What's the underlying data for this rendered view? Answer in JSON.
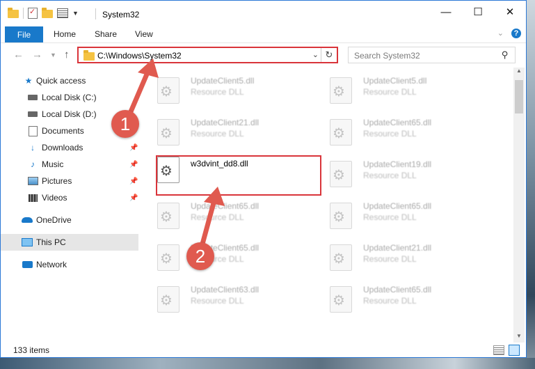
{
  "window": {
    "title": "System32",
    "controls": {
      "minimize": "—",
      "maximize": "☐",
      "close": "✕"
    }
  },
  "ribbon": {
    "tabs": [
      "File",
      "Home",
      "Share",
      "View"
    ],
    "help": "?"
  },
  "navigation": {
    "address": "C:\\Windows\\System32",
    "search_placeholder": "Search System32"
  },
  "sidebar": {
    "items": [
      {
        "label": "Quick access",
        "icon": "star-icon",
        "pinned": false
      },
      {
        "label": "Local Disk (C:)",
        "icon": "drive-icon",
        "pinned": false
      },
      {
        "label": "Local Disk (D:)",
        "icon": "drive-icon",
        "pinned": false
      },
      {
        "label": "Documents",
        "icon": "documents-icon",
        "pinned": true
      },
      {
        "label": "Downloads",
        "icon": "download-icon",
        "pinned": true
      },
      {
        "label": "Music",
        "icon": "music-icon",
        "pinned": true
      },
      {
        "label": "Pictures",
        "icon": "pictures-icon",
        "pinned": true
      },
      {
        "label": "Videos",
        "icon": "videos-icon",
        "pinned": true
      },
      {
        "label": "OneDrive",
        "icon": "onedrive-icon",
        "pinned": false
      },
      {
        "label": "This PC",
        "icon": "pc-icon",
        "pinned": false,
        "selected": true
      },
      {
        "label": "Network",
        "icon": "network-icon",
        "pinned": false
      }
    ]
  },
  "files": {
    "left_column": [
      {
        "name": "UpdateClient5.dll",
        "type": "Resource DLL"
      },
      {
        "name": "UpdateClient21.dll",
        "type": "Resource DLL"
      },
      {
        "name": "w3dvint_dd8.dll",
        "type": ""
      },
      {
        "name": "UpdateClient65.dll",
        "type": "Resource DLL"
      },
      {
        "name": "UpdateClient65.dll",
        "type": "Resource DLL"
      },
      {
        "name": "UpdateClient63.dll",
        "type": "Resource DLL"
      }
    ],
    "right_column": [
      {
        "name": "UpdateClient5.dll",
        "type": "Resource DLL"
      },
      {
        "name": "UpdateClient65.dll",
        "type": "Resource DLL"
      },
      {
        "name": "UpdateClient19.dll",
        "type": "Resource DLL"
      },
      {
        "name": "UpdateClient65.dll",
        "type": "Resource DLL"
      },
      {
        "name": "UpdateClient21.dll",
        "type": "Resource DLL"
      },
      {
        "name": "UpdateClient65.dll",
        "type": "Resource DLL"
      }
    ]
  },
  "status": {
    "item_count": "133 items"
  },
  "annotations": {
    "step1": "1",
    "step2": "2",
    "accent_color": "#e05a4f"
  }
}
